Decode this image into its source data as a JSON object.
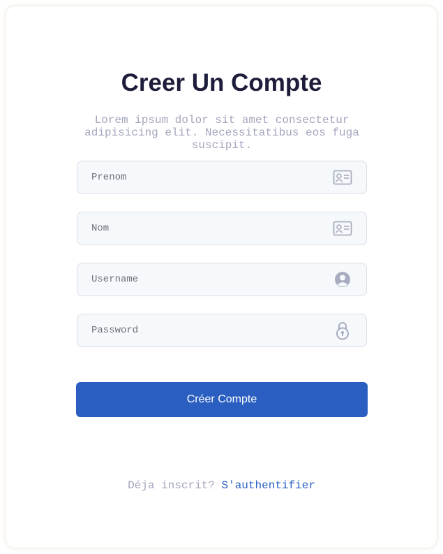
{
  "header": {
    "title": "Creer Un Compte",
    "subtitle": "Lorem ipsum dolor sit amet consectetur adipisicing elit. Necessitatibus eos fuga suscipit."
  },
  "form": {
    "fields": [
      {
        "placeholder": "Prenom",
        "value": "",
        "icon": "id-card-icon"
      },
      {
        "placeholder": "Nom",
        "value": "",
        "icon": "id-card-icon"
      },
      {
        "placeholder": "Username",
        "value": "",
        "icon": "user-circle-icon"
      },
      {
        "placeholder": "Password",
        "value": "",
        "icon": "lock-icon"
      }
    ],
    "submit_label": "Créer Compte"
  },
  "footer": {
    "prompt": "Déja inscrit?",
    "link_label": "S'authentifier"
  },
  "colors": {
    "primary": "#2a5fc1",
    "title": "#1d1d3b",
    "muted": "#a3a6bd",
    "field_bg": "#f6f9fb",
    "field_border": "#dcdde6",
    "icon": "#a9abbf"
  }
}
